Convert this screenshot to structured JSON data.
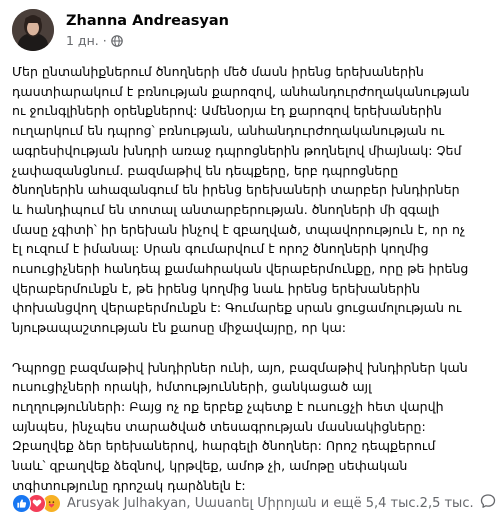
{
  "post": {
    "author": "Zhanna Andreasyan",
    "time": "1 дн.",
    "separator": "·",
    "paragraphs": [
      [
        "Մեր ընտանիքներում ծնողների մեծ մասն իրենց երեխաներին",
        "դաստիարակում է բռնության քարոզով, անհանդուրժողականության",
        "ու ջունգլիների օրենքներով: Ամենօրյա էդ քարոզով երեխաներին",
        "ուղարկում են դպրոց՝ բռնության, անհանդուրժողականության ու",
        "ագրեսիվության խնդրի առաջ դպրոցներին թողնելով միայնակ: Չեմ",
        "չափազանցնում. բազմաթիվ են դեպքերը, երբ դպրոցները",
        "ծնողներին  ահազանգում են իրենց երեխաների տարբեր խնդիրներ",
        "և հանդիպում են տոտալ անտարբերության. ծնողների մի զգալի",
        "մասը չգիտի՝ իր երեխան ինչով է զբաղված, տպավորություն է, որ ոչ",
        "էլ ուզում է իմանալ: Սրան գումարվում է որոշ ծնողների կողմից",
        "ուսուցիչների հանդեպ քամահրական վերաբերմունքը, որը թե իրենց",
        "վերաբերմունքն է, թե իրենց կողմից նաև իրենց երեխաներին",
        "փոխանցվող վերաբերմունքն է: Գումարեք սրան ցուցամոլության ու",
        "նյութապաշտության էն քաոսը միջավայրը, որ կա:"
      ],
      [
        "Դպրոցը բազմաթիվ խնդիրներ ունի, այո, բազմաթիվ խնդիրներ կան",
        "ուսուցիչների որակի, հմտությունների, ցանկացած այլ",
        "ուղղությունների: Բայց ոչ ոք երբեք չպետք է ուսուցչի հետ վարվի",
        "այնպես, ինչպես տարածված տեսագրության մասնակիցները:",
        "Զբաղվեք ձեր երեխաներով, հարգելի ծնողներ: Որոշ դեպքերում",
        "նաև՝ զբաղվեք ձեզնով, կրթվեք, ամոթ չի, ամոթը սեփական",
        "տգիտությունը դրոշակ դարձնելն է:"
      ]
    ]
  },
  "footer": {
    "reactions_text": "Arusyak Julhakyan, Սաuanել Միրոյան и ещё 5,4 тыс.",
    "comments_text": "2,5 тыс."
  },
  "icons": {
    "privacy": "globe-icon",
    "reactions": [
      "like-icon",
      "love-icon",
      "care-icon"
    ],
    "comments": "comment-icon"
  },
  "colors": {
    "like": "#1877f2",
    "love": "#f33e58",
    "care": "#f7b125",
    "secondary_text": "#65676b"
  }
}
